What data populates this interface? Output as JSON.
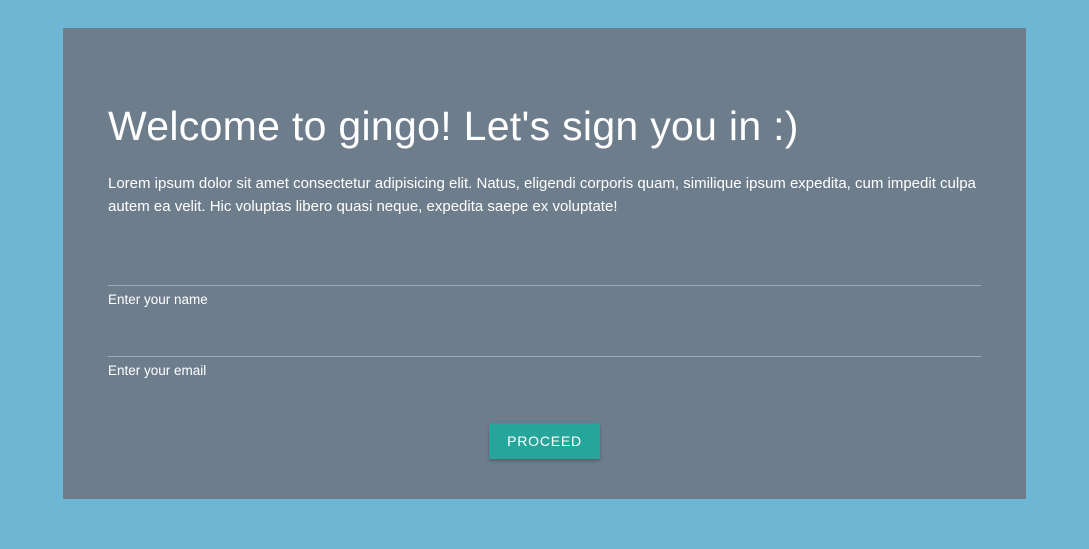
{
  "card": {
    "title": "Welcome to gingo! Let's sign you in :)",
    "description": "Lorem ipsum dolor sit amet consectetur adipisicing elit. Natus, eligendi corporis quam, similique ipsum expedita, cum impedit culpa autem ea velit. Hic voluptas libero quasi neque, expedita saepe ex voluptate!",
    "name_label": "Enter your name",
    "name_value": "",
    "email_label": "Enter your email",
    "email_value": "",
    "proceed_label": "Proceed"
  }
}
